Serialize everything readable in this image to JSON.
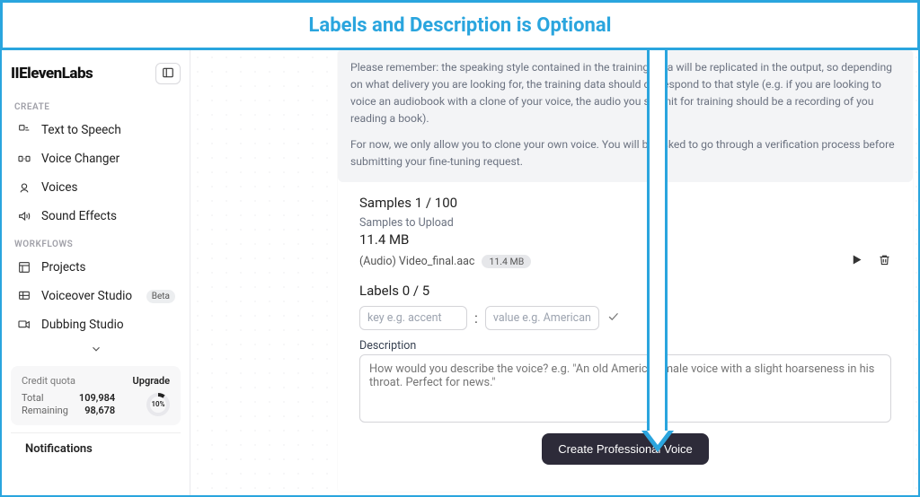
{
  "banner": {
    "title": "Labels and Description is Optional"
  },
  "brand": "IIElevenLabs",
  "sidebar": {
    "sections": {
      "create": "CREATE",
      "workflows": "WORKFLOWS"
    },
    "items": {
      "tts": "Text to Speech",
      "voice_changer": "Voice Changer",
      "voices": "Voices",
      "sound_effects": "Sound Effects",
      "projects": "Projects",
      "voiceover_studio": "Voiceover Studio",
      "dubbing_studio": "Dubbing Studio"
    },
    "beta": "Beta"
  },
  "quota": {
    "label": "Credit quota",
    "upgrade": "Upgrade",
    "total_label": "Total",
    "total_value": "109,984",
    "remaining_label": "Remaining",
    "remaining_value": "98,678",
    "ring": "10%"
  },
  "notifications": "Notifications",
  "info": {
    "p1": "Please remember: the speaking style contained in the training data will be replicated in the output, so depending on what delivery you are looking for, the training data should correspond to that style (e.g. if you are looking to voice an audiobook with a clone of your voice, the audio you submit for training should be a recording of you reading a book).",
    "p2": "For now, we only allow you to clone your own voice. You will be asked to go through a verification process before submitting your fine-tuning request."
  },
  "samples": {
    "title": "Samples  1 / 100",
    "upload_label": "Samples to Upload",
    "total_size": "11.4 MB",
    "file_name": "(Audio) Video_final.aac",
    "file_size": "11.4 MB"
  },
  "labels": {
    "title": "Labels  0 / 5",
    "key_placeholder": "key e.g. accent",
    "value_placeholder": "value e.g. American"
  },
  "description": {
    "label": "Description",
    "placeholder": "How would you describe the voice? e.g. \"An old American male voice with a slight hoarseness in his throat. Perfect for news.\""
  },
  "cta": "Create Professional Voice"
}
